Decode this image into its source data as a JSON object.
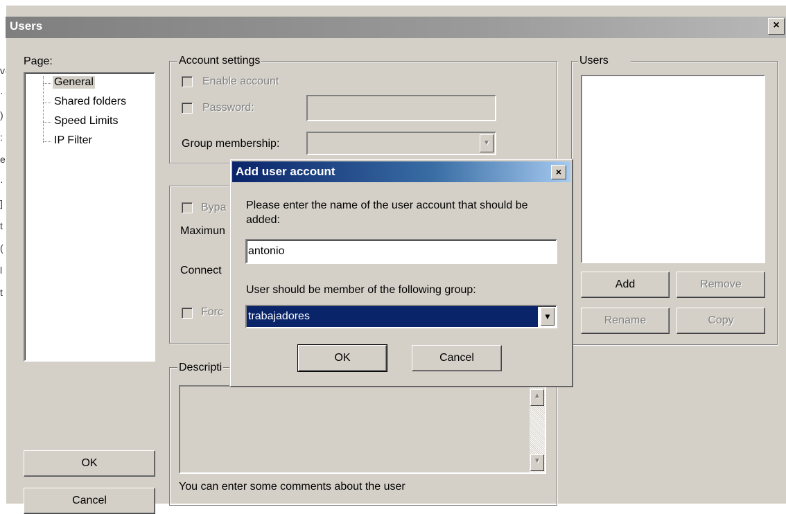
{
  "window": {
    "title": "Users",
    "close_glyph": "×"
  },
  "page": {
    "label": "Page:",
    "tree": [
      "General",
      "Shared folders",
      "Speed Limits",
      "IP Filter"
    ],
    "selected": "General"
  },
  "account_settings": {
    "legend": "Account settings",
    "enable_account": "Enable account",
    "password": "Password:",
    "password_value": "",
    "group_membership": "Group membership:",
    "group_value": ""
  },
  "options_group": {
    "bypass": "Bypa",
    "maximum": "Maximun",
    "connect": "Connect",
    "force": "Forc"
  },
  "description": {
    "legend": "Descripti",
    "hint": "You can enter some comments about the user"
  },
  "users_panel": {
    "legend": "Users",
    "buttons": {
      "add": "Add",
      "remove": "Remove",
      "rename": "Rename",
      "copy": "Copy"
    }
  },
  "footer": {
    "ok": "OK",
    "cancel": "Cancel"
  },
  "dialog": {
    "title": "Add user account",
    "close_glyph": "×",
    "prompt": "Please enter the name of the user account that should be added:",
    "username_value": "antonio",
    "group_prompt": "User should be member of the following group:",
    "group_value": "trabajadores",
    "ok": "OK",
    "cancel": "Cancel"
  },
  "icons": {
    "dropdown": "chevron-down-icon",
    "scroll_up": "scroll-up-icon",
    "scroll_down": "scroll-down-icon"
  }
}
